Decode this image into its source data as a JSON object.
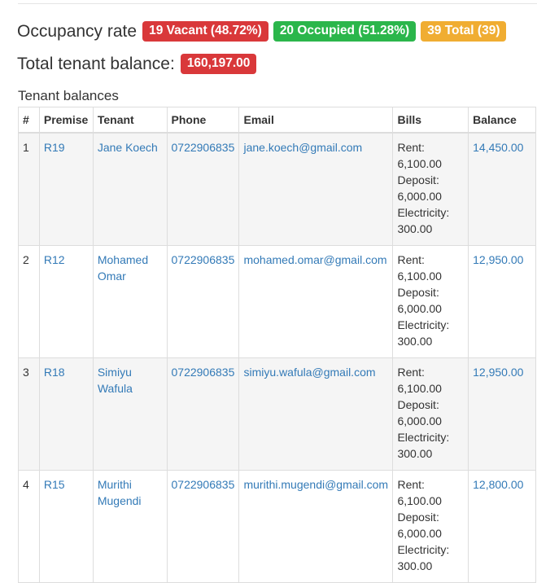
{
  "occupancy": {
    "label": "Occupancy rate",
    "vacant": "19 Vacant (48.72%)",
    "occupied": "20 Occupied (51.28%)",
    "total": "39 Total (39)"
  },
  "balance": {
    "label": "Total tenant balance:",
    "value": "160,197.00"
  },
  "table": {
    "caption": "Tenant balances",
    "headers": [
      "#",
      "Premise",
      "Tenant",
      "Phone",
      "Email",
      "Bills",
      "Balance"
    ],
    "rows": [
      {
        "num": "1",
        "premise": "R19",
        "tenant": "Jane Koech",
        "phone": "0722906835",
        "email": "jane.koech@gmail.com",
        "bills": [
          "Rent:",
          "6,100.00",
          "Deposit:",
          "6,000.00",
          "Electricity:",
          "300.00"
        ],
        "balance": "14,450.00"
      },
      {
        "num": "2",
        "premise": "R12",
        "tenant": "Mohamed Omar",
        "phone": "0722906835",
        "email": "mohamed.omar@gmail.com",
        "bills": [
          "Rent:",
          "6,100.00",
          "Deposit:",
          "6,000.00",
          "Electricity:",
          "300.00"
        ],
        "balance": "12,950.00"
      },
      {
        "num": "3",
        "premise": "R18",
        "tenant": "Simiyu Wafula",
        "phone": "0722906835",
        "email": "simiyu.wafula@gmail.com",
        "bills": [
          "Rent:",
          "6,100.00",
          "Deposit:",
          "6,000.00",
          "Electricity:",
          "300.00"
        ],
        "balance": "12,950.00"
      },
      {
        "num": "4",
        "premise": "R15",
        "tenant": "Murithi Mugendi",
        "phone": "0722906835",
        "email": "murithi.mugendi@gmail.com",
        "bills": [
          "Rent:",
          "6,100.00",
          "Deposit:",
          "6,000.00",
          "Electricity:",
          "300.00"
        ],
        "balance": "12,800.00"
      }
    ]
  },
  "colors": {
    "danger": "#d9383a",
    "success": "#2bb64b",
    "warning": "#f0ad32",
    "link": "#337ab7"
  }
}
